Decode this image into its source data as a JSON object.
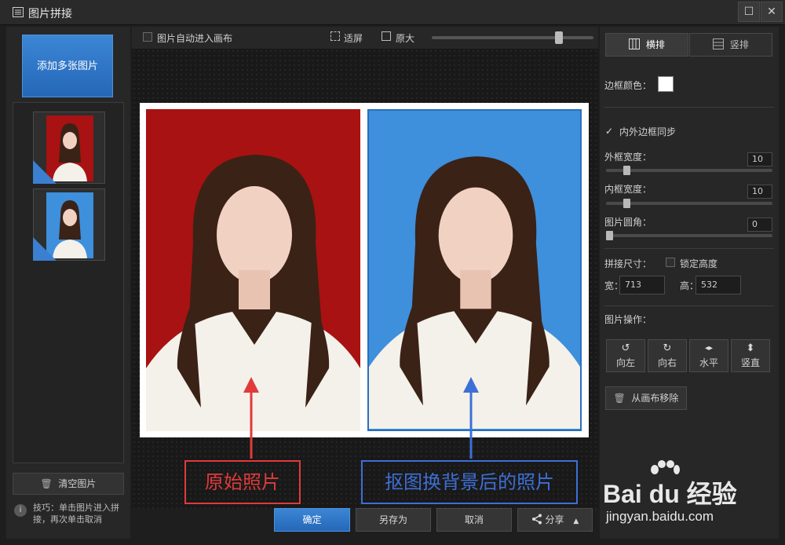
{
  "window": {
    "title": "图片拼接",
    "maximize_glyph": "☐",
    "close_glyph": "✕"
  },
  "left": {
    "add_button": "添加多张图片",
    "thumbnails": [
      {
        "background": "#a81212",
        "checked": true
      },
      {
        "background": "#3e8fdc",
        "checked": true
      }
    ],
    "clear_button": "清空图片",
    "tip_icon": "i",
    "tip_text": "技巧：单击图片进入拼接，再次单击取消"
  },
  "toolbar": {
    "auto_canvas_label": "图片自动进入画布",
    "fit_label": "适屏",
    "original_label": "原大",
    "zoom_level": 0.8
  },
  "canvas": {
    "left_photo_bg": "#a81212",
    "right_photo_bg": "#3e8fdc",
    "annotation_left": "原始照片",
    "annotation_right": "抠图换背景后的照片"
  },
  "bottom": {
    "ok": "确定",
    "save_as": "另存为",
    "cancel": "取消",
    "share": "分享"
  },
  "right": {
    "tab_horizontal": "横排",
    "tab_vertical": "竖排",
    "border_color_label": "边框颜色：",
    "sync_border_label": "内外边框同步",
    "outer_width_label": "外框宽度：",
    "outer_width_value": "10",
    "outer_width_level": 0.11,
    "inner_width_label": "内框宽度：",
    "inner_width_value": "10",
    "inner_width_level": 0.11,
    "corner_label": "图片圆角：",
    "corner_value": "0",
    "corner_level": 0,
    "size_label": "拼接尺寸：",
    "lock_height_label": "锁定高度",
    "width_label": "宽：",
    "width_value": "713",
    "height_label": "高：",
    "height_value": "532",
    "ops_label": "图片操作：",
    "ops": [
      {
        "label": "向左",
        "icon": "rotate-left-icon",
        "glyph": "↺"
      },
      {
        "label": "向右",
        "icon": "rotate-right-icon",
        "glyph": "↻"
      },
      {
        "label": "水平",
        "icon": "flip-horizontal-icon",
        "glyph": "◂▸"
      },
      {
        "label": "竖直",
        "icon": "flip-vertical-icon",
        "glyph": "⬍"
      }
    ],
    "remove_button": "从画布移除"
  },
  "watermark": {
    "brand": "Bai du 经验",
    "url": "jingyan.baidu.com"
  },
  "colors": {
    "accent": "#2f78cc",
    "annotation_red": "#e03a3a",
    "annotation_blue": "#3d6fd6"
  }
}
